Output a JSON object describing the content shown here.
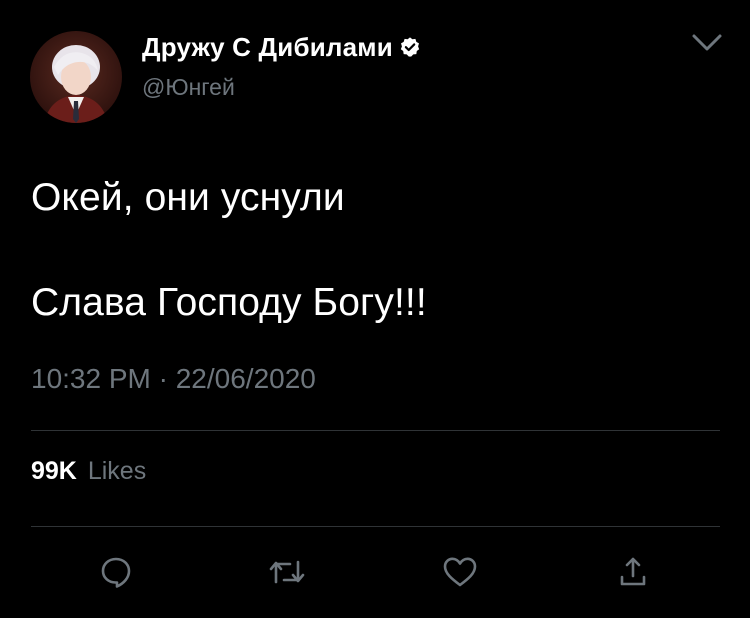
{
  "tweet": {
    "author": {
      "display_name": "Дружу С Дибилами",
      "handle": "@Юнгей",
      "verified": true
    },
    "text_lines": [
      "Окей, они уснули",
      "Слава Господу Богу!!!"
    ],
    "timestamp": "10:32 PM · 22/06/2020",
    "likes": {
      "count": "99K",
      "label": "Likes"
    }
  },
  "actions": {
    "reply_icon": "speech-bubble-icon",
    "retweet_icon": "retweet-arrows-icon",
    "like_icon": "heart-icon",
    "share_icon": "share-upload-icon"
  },
  "colors": {
    "background": "#000000",
    "text_primary": "#ffffff",
    "text_secondary": "#6e767d",
    "divider": "#2f3336",
    "icon": "#6e767d"
  }
}
